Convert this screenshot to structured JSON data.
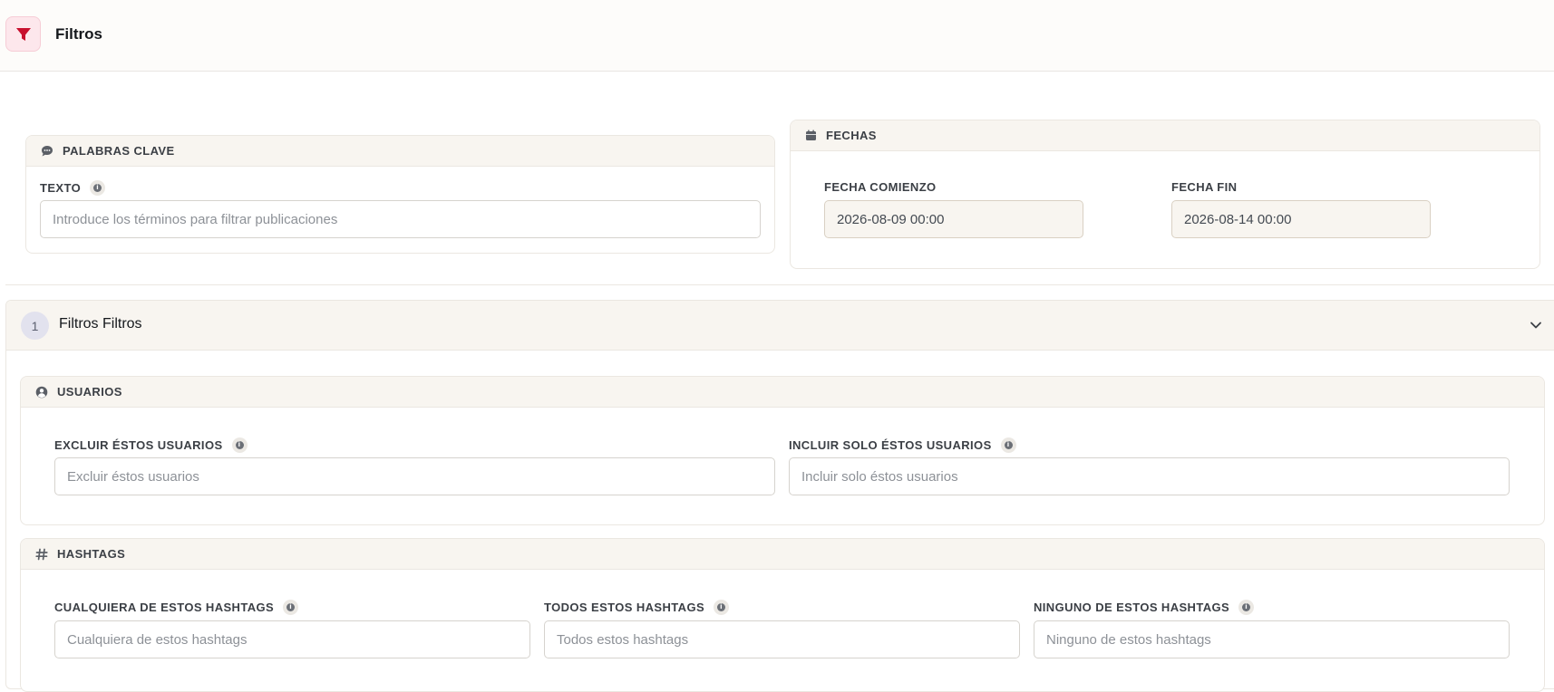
{
  "header": {
    "title": "Filtros",
    "icon": "filter-icon"
  },
  "keywords": {
    "heading": "PALABRAS CLAVE",
    "icon": "chat-bubble-icon",
    "text_label": "TEXTO",
    "text_placeholder": "Introduce los términos para filtrar publicaciones",
    "text_value": ""
  },
  "dates": {
    "heading": "FECHAS",
    "icon": "calendar-icon",
    "start_label": "FECHA COMIENZO",
    "start_value": "2026-08-09 00:00",
    "end_label": "FECHA FIN",
    "end_value": "2026-08-14 00:00"
  },
  "section": {
    "number": "1",
    "title": "Filtros Filtros",
    "expanded": true
  },
  "users": {
    "heading": "USUARIOS",
    "icon": "user-circle-icon",
    "exclude_label": "EXCLUIR ÉSTOS USUARIOS",
    "exclude_placeholder": "Excluir éstos usuarios",
    "include_label": "INCLUIR SOLO ÉSTOS USUARIOS",
    "include_placeholder": "Incluir solo éstos usuarios"
  },
  "hashtags": {
    "heading": "HASHTAGS",
    "icon": "hash-icon",
    "any_label": "CUALQUIERA DE ESTOS HASHTAGS",
    "any_placeholder": "Cualquiera de estos hashtags",
    "all_label": "TODOS ESTOS HASHTAGS",
    "all_placeholder": "Todos estos hashtags",
    "none_label": "NINGUNO DE ESTOS HASHTAGS",
    "none_placeholder": "Ninguno de estos hashtags"
  },
  "colors": {
    "accent": "#c8102e",
    "card_header_bg": "#f8f5f0",
    "border": "#ebe7e1"
  }
}
